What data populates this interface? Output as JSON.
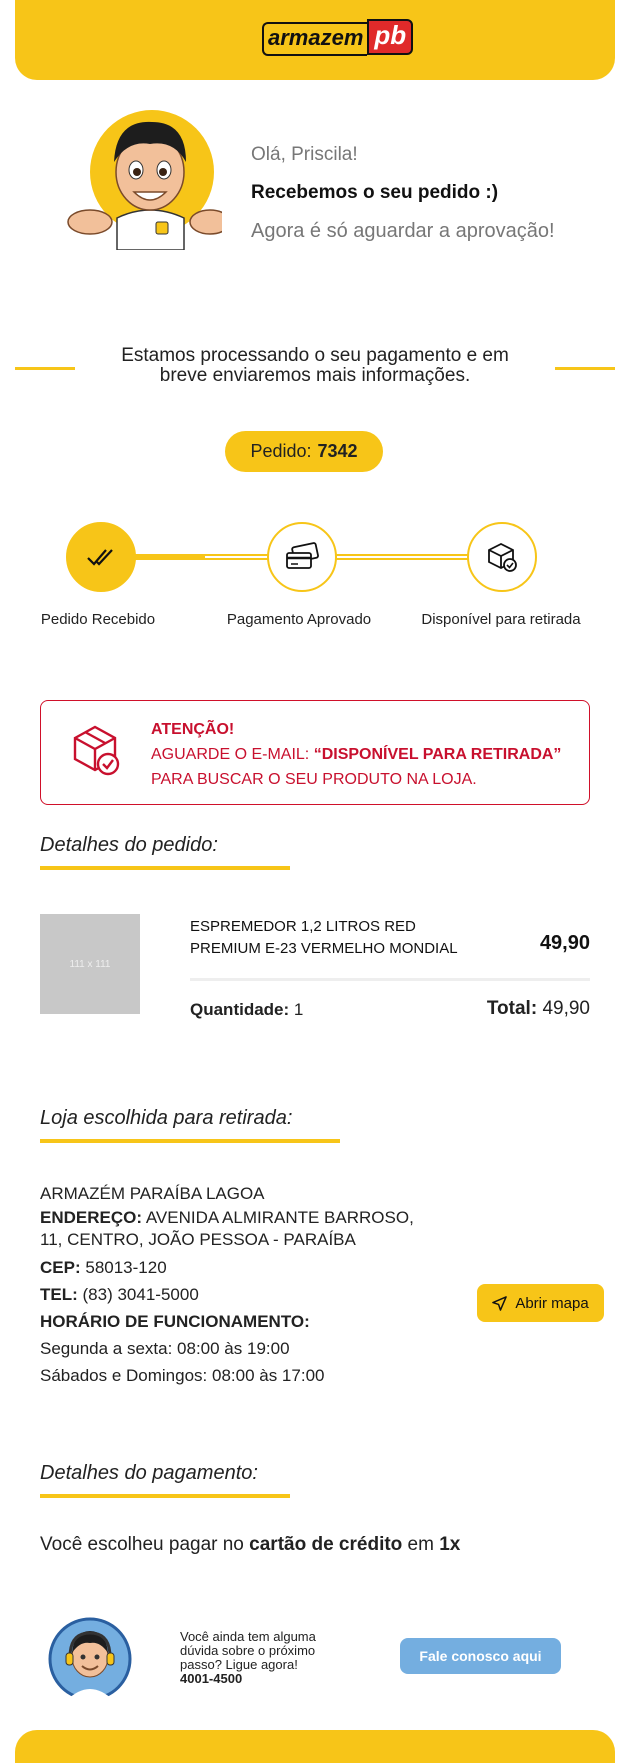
{
  "header": {
    "logo_main": "armazem",
    "logo_suffix": "pb"
  },
  "greeting": {
    "hello": "Olá, Priscila!",
    "received": "Recebemos o seu pedido :)",
    "wait": "Agora é só aguardar a aprovação!"
  },
  "processing": {
    "line1": "Estamos processando o seu pagamento e em",
    "line2": "breve enviaremos mais informações."
  },
  "order": {
    "label": "Pedido:",
    "number": "7342"
  },
  "steps": [
    {
      "label": "Pedido Recebido",
      "icon": "double-check-icon"
    },
    {
      "label": "Pagamento Aprovado",
      "icon": "credit-card-icon"
    },
    {
      "label": "Disponível para retirada",
      "icon": "box-check-icon"
    }
  ],
  "steps_progress": 0.3,
  "alert": {
    "title": "ATENÇÃO!",
    "line2_prefix": "AGUARDE O E-MAIL: ",
    "line2_emphasis": "“DISPONÍVEL PARA RETIRADA”",
    "line3": "PARA BUSCAR O SEU PRODUTO NA LOJA."
  },
  "order_details": {
    "title": "Detalhes do pedido:",
    "product": {
      "thumb_placeholder": "111 x 111",
      "name_line1": "ESPREMEDOR 1,2 LITROS RED",
      "name_line2": "PREMIUM E-23 VERMELHO MONDIAL",
      "price": "49,90",
      "qty_label": "Quantidade:",
      "qty_value": "1",
      "total_label": "Total:",
      "total_value": "49,90"
    }
  },
  "store": {
    "title": "Loja escolhida para retirada:",
    "name": "ARMAZÉM PARAÍBA LAGOA",
    "address_label": "ENDEREÇO:",
    "address_line1": "AVENIDA ALMIRANTE BARROSO,",
    "address_line2": "11, CENTRO, JOÃO PESSOA - PARAÍBA",
    "cep_label": "CEP:",
    "cep_value": "58013-120",
    "tel_label": "TEL:",
    "tel_value": "(83) 3041-5000",
    "hours_label": "HORÁRIO DE FUNCIONAMENTO:",
    "hours_week": "Segunda a sexta: 08:00 às 19:00",
    "hours_weekend": "Sábados e Domingos: 08:00 às 17:00",
    "map_button": "Abrir mapa"
  },
  "payment": {
    "title": "Detalhes do pagamento:",
    "prefix": "Você escolheu pagar no ",
    "method": "cartão de crédito",
    "middle": " em ",
    "installments": "1x"
  },
  "help": {
    "text": "Você ainda tem alguma dúvida sobre o próximo passo? Ligue agora!",
    "phone": "4001-4500",
    "button": "Fale conosco aqui"
  },
  "colors": {
    "brand_yellow": "#f7c518",
    "alert_red": "#c8102e",
    "help_blue": "#74aee0",
    "logo_red": "#e02a2a"
  }
}
